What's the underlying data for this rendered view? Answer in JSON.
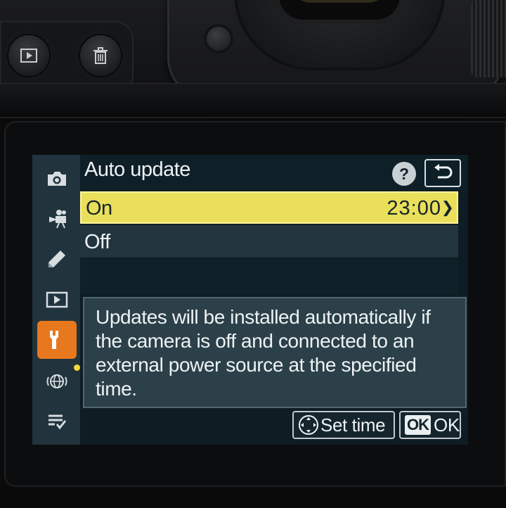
{
  "header": {
    "title": "Auto update",
    "help_label": "?"
  },
  "sidebar": {
    "items": [
      {
        "icon": "camera-icon",
        "active": false
      },
      {
        "icon": "movie-camera-icon",
        "active": false
      },
      {
        "icon": "pencil-icon",
        "active": false
      },
      {
        "icon": "playback-icon",
        "active": false
      },
      {
        "icon": "wrench-icon",
        "active": true
      },
      {
        "icon": "network-icon",
        "active": false,
        "notification_dot": true
      },
      {
        "icon": "my-menu-icon",
        "active": false
      }
    ]
  },
  "options": [
    {
      "label": "On",
      "value": "23:00",
      "selected": true
    },
    {
      "label": "Off",
      "selected": false
    }
  ],
  "info_text": "Updates will be installed automatically if the camera is off and connected to an external power source at the specified time.",
  "footer": {
    "set_time_label": "Set time",
    "ok_badge": "OK",
    "ok_label": "OK"
  },
  "colors": {
    "selected_row": "#eadf5a",
    "active_tab": "#e8781e",
    "screen_bg": "#0e1c24",
    "notification_dot": "#f3d83c"
  }
}
